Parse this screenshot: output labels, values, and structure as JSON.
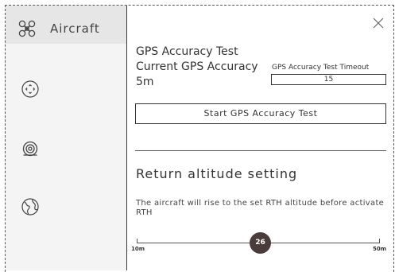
{
  "sidebar": {
    "title": "Aircraft",
    "items": [
      {
        "icon": "drone-icon"
      },
      {
        "icon": "gimbal-control-icon"
      },
      {
        "icon": "camera-icon"
      },
      {
        "icon": "globe-icon"
      }
    ]
  },
  "gps": {
    "title": "GPS Accuracy Test",
    "current_label": "Current GPS Accuracy",
    "current_value": "5m",
    "timeout_label": "GPS Accuracy Test Timeout",
    "timeout_value": "15",
    "start_button": "Start  GPS Accuracy Test"
  },
  "rth": {
    "title": "Return altitude setting",
    "description": "The aircraft will rise to the set RTH altitude before activate RTH",
    "slider": {
      "min_label": "10m",
      "max_label": "50m",
      "min": 10,
      "max": 50,
      "value": 26,
      "value_label": "26"
    }
  },
  "colors": {
    "sidebar_bg": "#f4f4f4",
    "sidebar_header_bg": "#e6e6e6",
    "thumb": "#4a3c3a",
    "text": "#333333"
  }
}
